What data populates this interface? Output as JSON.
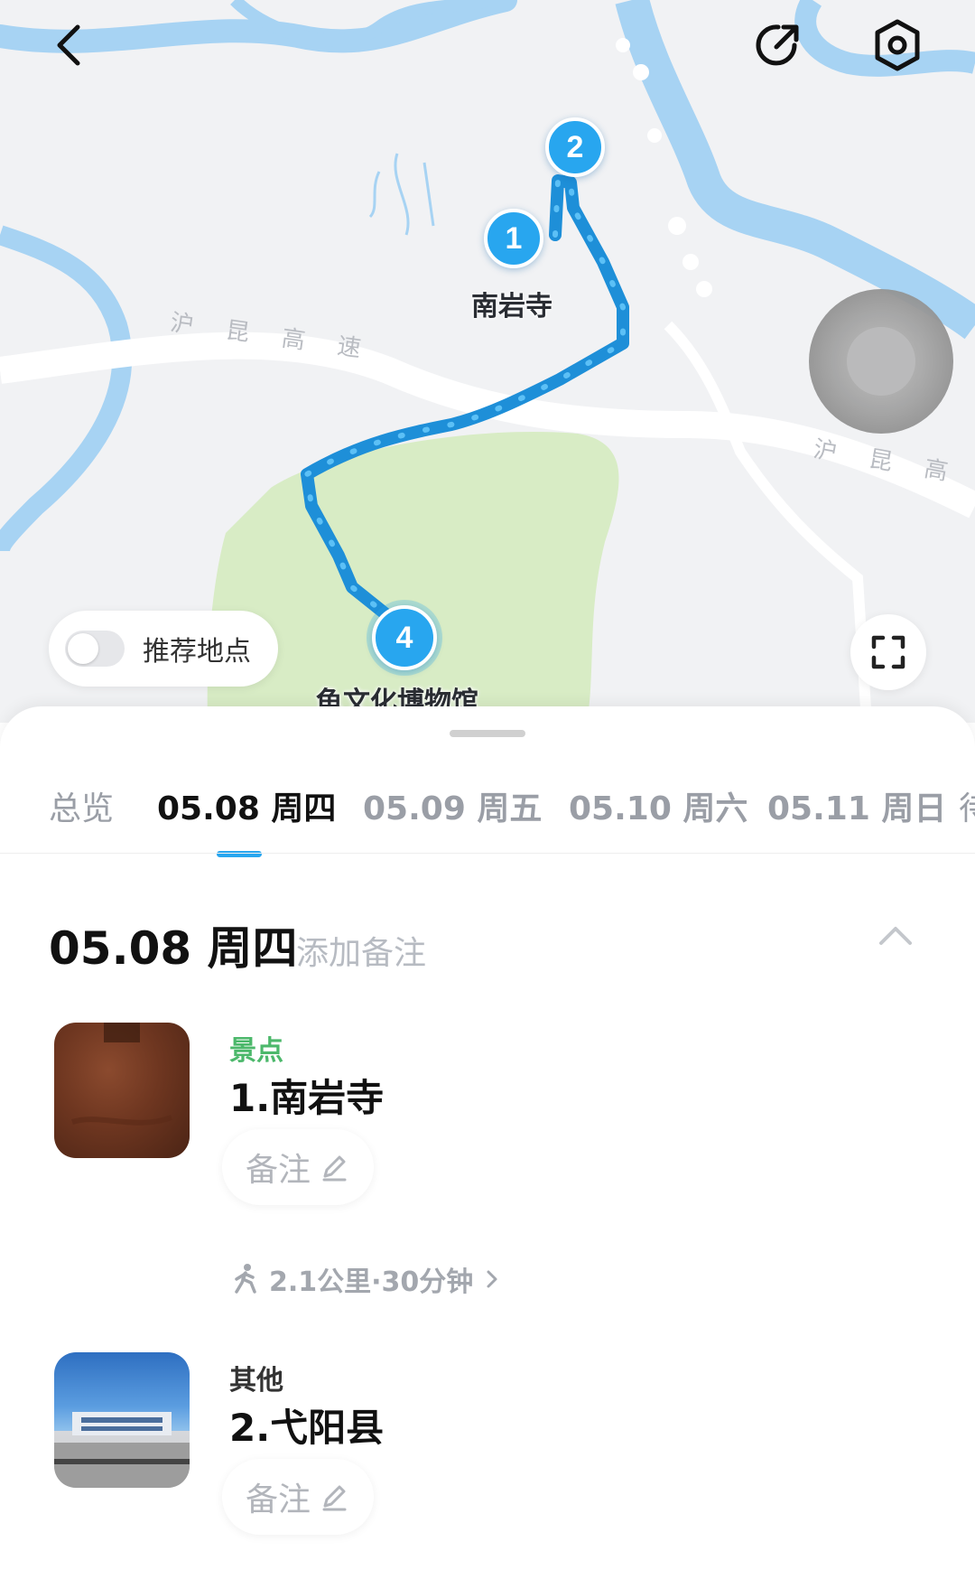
{
  "map": {
    "road_label_1": "沪 昆 高 速",
    "road_label_2": "沪 昆 高 速",
    "markers": [
      {
        "number": "1",
        "label": "南岩寺"
      },
      {
        "number": "2"
      },
      {
        "number": "4",
        "label": "龟文化博物馆"
      }
    ],
    "toggle_label": "推荐地点",
    "toggle_on": false,
    "icons": {
      "back": "chevron-left-icon",
      "share": "share-icon",
      "settings": "settings-icon",
      "fullscreen": "fullscreen-icon"
    },
    "colors": {
      "route": "#28a6ef",
      "water": "#a7d3f3",
      "park": "#d8ecc5"
    }
  },
  "tabs": [
    {
      "label": "总览",
      "active": false
    },
    {
      "label": "05.08 周四",
      "active": true
    },
    {
      "label": "05.09 周五",
      "active": false
    },
    {
      "label": "05.10 周六",
      "active": false
    },
    {
      "label": "05.11 周日",
      "active": false
    },
    {
      "label": "待",
      "active": false
    }
  ],
  "day": {
    "title": "05.08 周四",
    "add_note": "添加备注"
  },
  "pois": [
    {
      "category": "景点",
      "name": "1.南岩寺",
      "note_label": "备注"
    },
    {
      "category": "其他",
      "name": "2.弋阳县",
      "note_label": "备注"
    }
  ],
  "route_segment": {
    "text": "2.1公里·30分钟"
  }
}
